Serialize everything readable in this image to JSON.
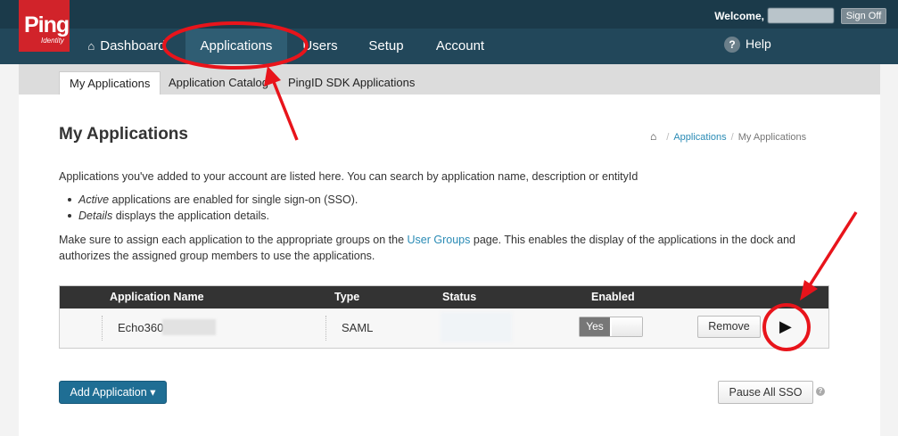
{
  "header": {
    "welcome_label": "Welcome,",
    "sign_off_label": "Sign Off",
    "logo_text": "Ping",
    "logo_sub": "Identity"
  },
  "nav": {
    "items": [
      {
        "label": "Dashboard",
        "icon": "home-icon"
      },
      {
        "label": "Applications",
        "active": true
      },
      {
        "label": "Users"
      },
      {
        "label": "Setup"
      },
      {
        "label": "Account"
      }
    ],
    "help_label": "Help"
  },
  "subnav": {
    "tabs": [
      {
        "label": "My Applications",
        "active": true
      },
      {
        "label": "Application Catalog"
      },
      {
        "label": "PingID SDK Applications"
      }
    ]
  },
  "page": {
    "title": "My Applications",
    "breadcrumb": {
      "link": "Applications",
      "current": "My Applications",
      "sep": "/"
    },
    "intro": "Applications you've added to your account are listed here. You can search by application name, description or entityId",
    "bullet1_em": "Active",
    "bullet1_rest": " applications are enabled for single sign-on (SSO).",
    "bullet2_em": "Details",
    "bullet2_rest": " displays the application details.",
    "groups_pre": "Make sure to assign each application to the appropriate groups on the ",
    "groups_link": "User Groups",
    "groups_post": " page. This enables the display of the applications in the dock and",
    "groups_line2": "authorizes the assigned group members to use the applications."
  },
  "table": {
    "headers": [
      "Application Name",
      "Type",
      "Status",
      "Enabled"
    ],
    "rows": [
      {
        "name": "Echo360",
        "type": "SAML",
        "enabled": "Yes",
        "remove_label": "Remove"
      }
    ]
  },
  "actions": {
    "add_application_label": "Add Application",
    "pause_all_label": "Pause All SSO"
  },
  "colors": {
    "topbar": "#1b3a4a",
    "navbar": "#22475a",
    "brand_red": "#d1232a",
    "link": "#2a8bb5",
    "primary_button": "#1f6e94",
    "annotation": "#e8141b"
  }
}
